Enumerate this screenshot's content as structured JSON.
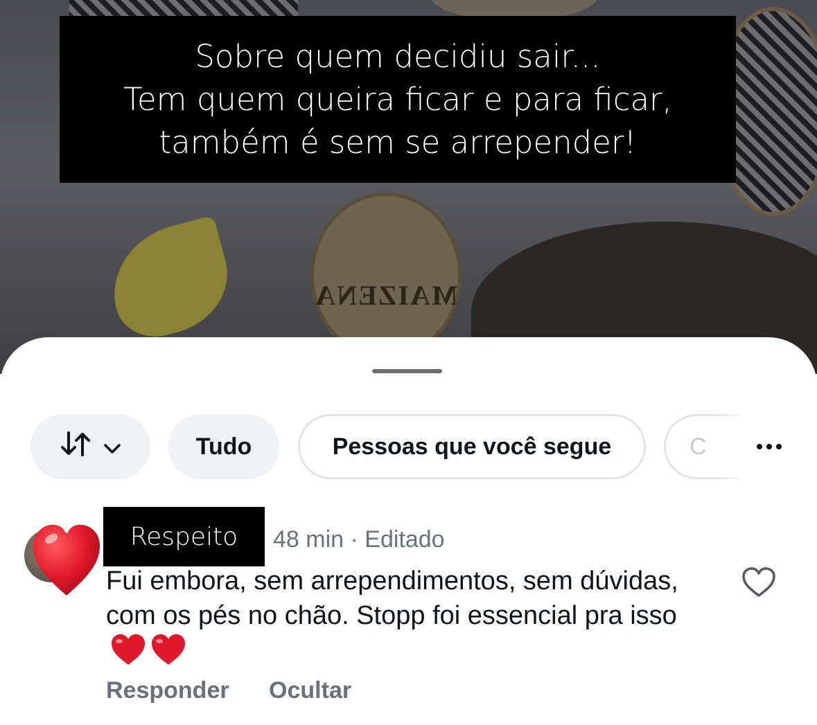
{
  "story": {
    "caption_lines": [
      "Sobre quem decidiu sair...",
      "Tem quem queira ficar e para ficar,",
      "também é sem se arrepender!"
    ],
    "plate_text": "MAIZENA"
  },
  "filters": {
    "sort_icon": "sort-arrows-icon",
    "chevron_icon": "chevron-down-icon",
    "all_label": "Tudo",
    "following_label": "Pessoas que você segue",
    "partial_label": "C",
    "more_icon": "more-horizontal-icon"
  },
  "comment": {
    "author": "Respeito",
    "meta": "48 min · Editado",
    "text": "Fui embora, sem arrependimentos, sem dúvidas, com os pés no chão.  Stopp foi essencial pra isso",
    "emoji": "❤️❤️",
    "reply_label": "Responder",
    "hide_label": "Ocultar",
    "like_icon": "heart-outline-icon"
  },
  "colors": {
    "heart_red": "#e0182b",
    "text_primary": "#0f1419",
    "text_secondary": "#6b7178",
    "chip_bg": "#eff1f4"
  }
}
